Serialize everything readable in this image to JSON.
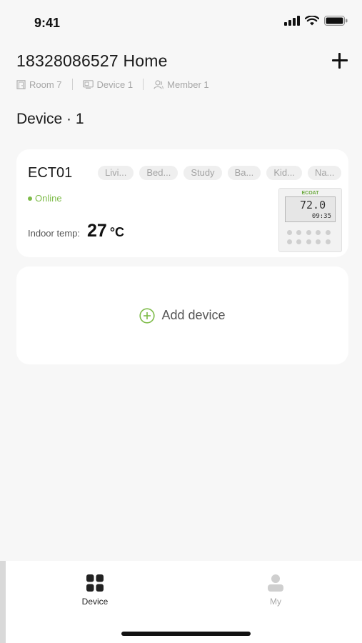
{
  "status_bar": {
    "time": "9:41"
  },
  "home": {
    "title": "18328086527 Home",
    "room_label": "Room 7",
    "device_label": "Device 1",
    "member_label": "Member 1"
  },
  "section": {
    "title": "Device · 1"
  },
  "device": {
    "name": "ECT01",
    "rooms": [
      "Livi...",
      "Bed...",
      "Study",
      "Ba...",
      "Kid...",
      "Na..."
    ],
    "status": "Online",
    "temp_label": "Indoor temp:",
    "temp_value": "27",
    "temp_unit": "°C",
    "image": {
      "brand": "ECOAT",
      "screen_temp": "72.0",
      "screen_time": "09:35"
    }
  },
  "add_device": {
    "label": "Add device"
  },
  "tabs": [
    {
      "label": "Device",
      "active": true,
      "icon": "grid-icon"
    },
    {
      "label": "My",
      "active": false,
      "icon": "person-icon"
    }
  ],
  "colors": {
    "accent_green": "#7dbb48",
    "background": "#f7f7f7",
    "card": "#ffffff"
  }
}
